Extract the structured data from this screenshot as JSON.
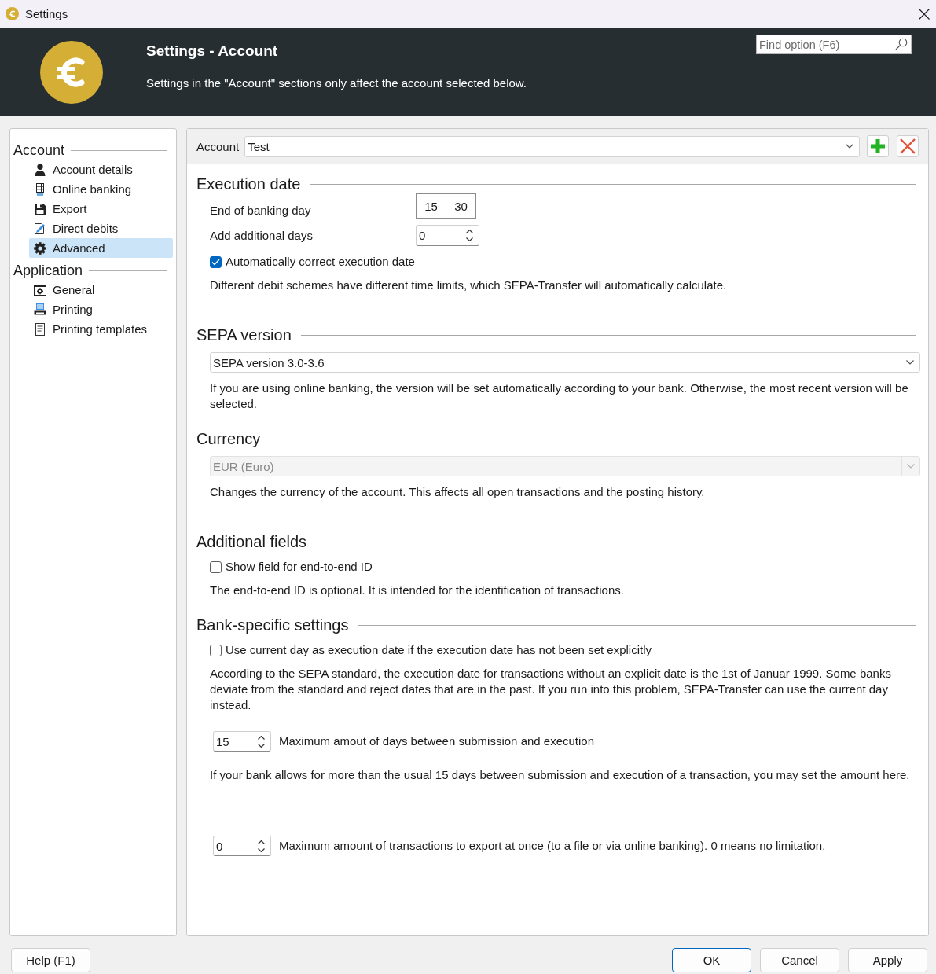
{
  "window": {
    "title": "Settings"
  },
  "header": {
    "title": "Settings - Account",
    "subtitle": "Settings in the \"Account\" sections only affect the account selected below.",
    "search": {
      "placeholder": "Find option (F6)"
    }
  },
  "sidebar": {
    "groups": [
      {
        "label": "Account",
        "items": [
          {
            "label": "Account details",
            "selected": false
          },
          {
            "label": "Online banking",
            "selected": false
          },
          {
            "label": "Export",
            "selected": false
          },
          {
            "label": "Direct debits",
            "selected": false
          },
          {
            "label": "Advanced",
            "selected": true
          }
        ]
      },
      {
        "label": "Application",
        "items": [
          {
            "label": "General",
            "selected": false
          },
          {
            "label": "Printing",
            "selected": false
          },
          {
            "label": "Printing templates",
            "selected": false
          }
        ]
      }
    ]
  },
  "account_bar": {
    "label": "Account",
    "value": "Test"
  },
  "sections": [
    {
      "title": "Execution date",
      "rows": [
        {
          "kind": "time",
          "label": "End of banking day",
          "hours": "15",
          "minutes": "30"
        },
        {
          "kind": "spinner",
          "label": "Add additional days",
          "value": "0"
        },
        {
          "kind": "checkbox",
          "label": "Automatically correct execution date",
          "checked": true
        },
        {
          "kind": "text",
          "text": "Different debit schemes have different time limits, which SEPA-Transfer will automatically calculate."
        }
      ]
    },
    {
      "title": "SEPA version",
      "rows": [
        {
          "kind": "select",
          "value": "SEPA version 3.0-3.6",
          "disabled": false
        },
        {
          "kind": "text",
          "text": "If you are using online banking, the version will be set automatically according to your bank. Otherwise, the most recent version will be selected."
        }
      ]
    },
    {
      "title": "Currency",
      "rows": [
        {
          "kind": "select",
          "value": "EUR (Euro)",
          "disabled": true
        },
        {
          "kind": "text",
          "text": "Changes the currency of the account. This affects all open transactions and the posting history."
        }
      ]
    },
    {
      "title": "Additional fields",
      "rows": [
        {
          "kind": "checkbox",
          "label": "Show field for end-to-end ID",
          "checked": false
        },
        {
          "kind": "text",
          "text": "The end-to-end ID is optional. It is intended for the identification of transactions."
        }
      ]
    },
    {
      "title": "Bank-specific settings",
      "rows": [
        {
          "kind": "checkbox",
          "label": "Use current day as execution date if the execution date has not been set explicitly",
          "checked": false
        },
        {
          "kind": "text",
          "text": "According to the SEPA standard, the execution date for transactions without an explicit date is the 1st of Januar 1999. Some banks deviate from the standard and reject dates that are in the past. If you run into this problem, SEPA-Transfer can use the current day instead."
        },
        {
          "kind": "inline_spinner",
          "value": "15",
          "label": "Maximum amout of days between submission and execution"
        },
        {
          "kind": "text",
          "text": "If your bank allows for more than the usual 15 days between submission and execution of a transaction, you may set the amount here."
        },
        {
          "kind": "inline_spinner",
          "value": "0",
          "label": "Maximum amount of transactions to export at once (to a file or via online banking). 0 means no limitation."
        }
      ]
    }
  ],
  "footer": {
    "left_buttons": [
      {
        "label": "Help (F1)",
        "default": false
      }
    ],
    "right_buttons": [
      {
        "label": "OK",
        "default": true
      },
      {
        "label": "Cancel",
        "default": false
      },
      {
        "label": "Apply",
        "default": false
      }
    ]
  }
}
